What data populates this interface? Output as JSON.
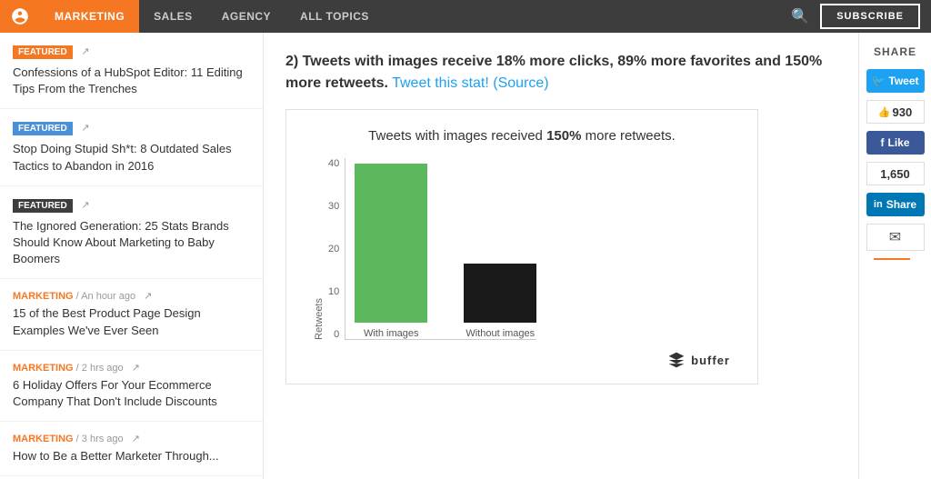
{
  "nav": {
    "logo_alt": "HubSpot",
    "items": [
      {
        "label": "MARKETING",
        "active": true
      },
      {
        "label": "SALES",
        "active": false
      },
      {
        "label": "AGENCY",
        "active": false
      },
      {
        "label": "ALL TOPICS",
        "active": false
      }
    ],
    "subscribe_label": "SUBSCRIBE"
  },
  "sidebar": {
    "items": [
      {
        "badge": "FEATURED",
        "badge_type": "orange",
        "title": "Confessions of a HubSpot Editor: 11 Editing Tips From the Trenches"
      },
      {
        "badge": "FEATURED",
        "badge_type": "blue",
        "title": "Stop Doing Stupid Sh*t: 8 Outdated Sales Tactics to Abandon in 2016"
      },
      {
        "badge": "FEATURED",
        "badge_type": "dark",
        "title": "The Ignored Generation: 25 Stats Brands Should Know About Marketing to Baby Boomers"
      },
      {
        "category": "MARKETING",
        "time": "An hour ago",
        "title": "15 of the Best Product Page Design Examples We've Ever Seen"
      },
      {
        "category": "MARKETING",
        "time": "2 hrs ago",
        "title": "6 Holiday Offers For Your Ecommerce Company That Don't Include Discounts"
      },
      {
        "category": "MARKETING",
        "time": "3 hrs ago",
        "title": "How to Be a Better Marketer Through..."
      }
    ]
  },
  "article": {
    "stat_text": "2) Tweets with images receive 18% more clicks, 89% more favorites and 150% more retweets.",
    "tweet_link": "Tweet this stat!",
    "source_link": "(Source)",
    "chart": {
      "title_prefix": "Tweets with images received ",
      "title_highlight": "150%",
      "title_suffix": " more retweets.",
      "y_labels": [
        "40",
        "30",
        "20",
        "10",
        "0"
      ],
      "bars": [
        {
          "label": "With images",
          "color": "green",
          "height": 175
        },
        {
          "label": "Without images",
          "color": "black",
          "height": 65
        }
      ],
      "y_axis_label": "Retweets",
      "powered_by": "buffer"
    }
  },
  "share": {
    "title": "SHARE",
    "twitter_label": "Tweet",
    "twitter_count": "930",
    "facebook_label": "Like",
    "facebook_count": "1,650",
    "linkedin_label": "Share"
  }
}
